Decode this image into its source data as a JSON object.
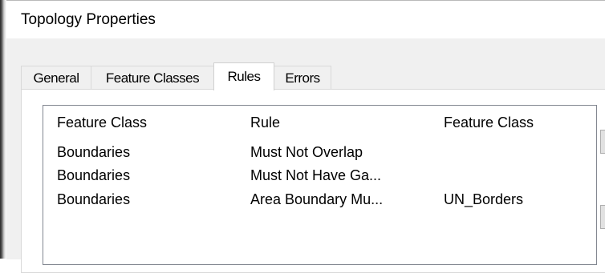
{
  "window": {
    "title": "Topology Properties"
  },
  "tabs": [
    {
      "label": "General",
      "active": false
    },
    {
      "label": "Feature Classes",
      "active": false
    },
    {
      "label": "Rules",
      "active": true
    },
    {
      "label": "Errors",
      "active": false
    }
  ],
  "rules_list": {
    "columns": [
      "Feature Class",
      "Rule",
      "Feature Class"
    ],
    "rows": [
      {
        "feature_class": "Boundaries",
        "rule": "Must Not Overlap",
        "feature_class_2": ""
      },
      {
        "feature_class": "Boundaries",
        "rule": "Must Not Have Ga...",
        "feature_class_2": ""
      },
      {
        "feature_class": "Boundaries",
        "rule": "Area Boundary Mu...",
        "feature_class_2": "UN_Borders"
      }
    ]
  },
  "colors": {
    "dialog_background": "#f0f0f0",
    "panel_background": "#ffffff",
    "list_border": "#828790",
    "tab_border": "#d9d9d9"
  }
}
